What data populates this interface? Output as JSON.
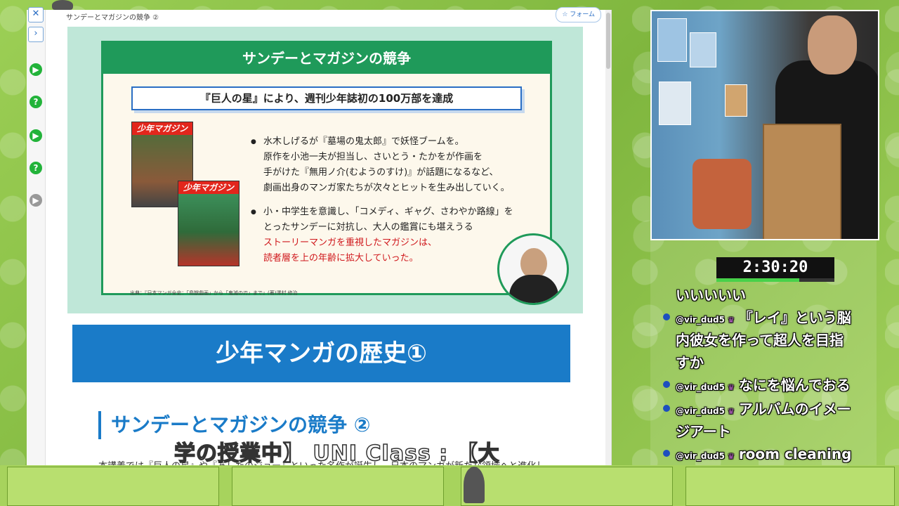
{
  "browser": {
    "tab_title": "サンデーとマガジンの競争 ②",
    "follow_label": "フォーム",
    "sidebar_icons": [
      "close-icon",
      "chevron-right-icon",
      "play-icon",
      "help-icon",
      "play-icon",
      "help-icon",
      "play-icon"
    ]
  },
  "slide": {
    "header": "サンデーとマガジンの競争",
    "subheader": "『巨人の星』により、週刊少年誌初の100万部を達成",
    "cover1_mast": "少年マガジン",
    "cover2_mast": "少年マガジン",
    "bullet1_lines": [
      "水木しげるが『墓場の鬼太郎』で妖怪ブームを。",
      "原作を小池一夫が担当し、さいとう・たかをが作画を",
      "手がけた『無用ノ介(むようのすけ)』が話題になるなど、",
      "劇画出身のマンガ家たちが次々とヒットを生み出していく。"
    ],
    "bullet2_lines": [
      "小・中学生を意識し、「コメディ、ギャグ、さわやか路線」を",
      "とったサンデーに対抗し、大人の鑑賞にも堪えうる"
    ],
    "bullet2_red_lines": [
      "ストーリーマンガを重視したマガジンは、",
      "読者層を上の年齢に拡大していった。"
    ],
    "source": "出典：『日本マンガ全史：「鳥獣戯画」から「鬼滅の刃」まで』(著)澤村 修治"
  },
  "page": {
    "banner": "少年マンガの歴史①",
    "section_title": "サンデーとマガジンの競争 ②",
    "body_line": "本講義では『巨人の星』や『あしたのジョー』といった名作が誕生し、日本のマンガが新たな領域へと進化し"
  },
  "overlay": {
    "caption": "学の授業中】 UNI Class : 【大"
  },
  "stream": {
    "timer": "2:30:20",
    "timer_progress": 0.7
  },
  "chat": {
    "messages": [
      {
        "user": "",
        "text": "いいいいい"
      },
      {
        "user": "@vir_dud5",
        "text": "『レイ』という脳"
      },
      {
        "user": "",
        "text": "内彼女を作って超人を目指"
      },
      {
        "user": "",
        "text": "すか"
      },
      {
        "user": "@vir_dud5",
        "text": "なにを悩んでおる"
      },
      {
        "user": "@vir_dud5",
        "text": "アルバムのイメー"
      },
      {
        "user": "",
        "text": "ジアート"
      },
      {
        "user": "@vir_dud5",
        "text": "room cleaning"
      }
    ]
  }
}
